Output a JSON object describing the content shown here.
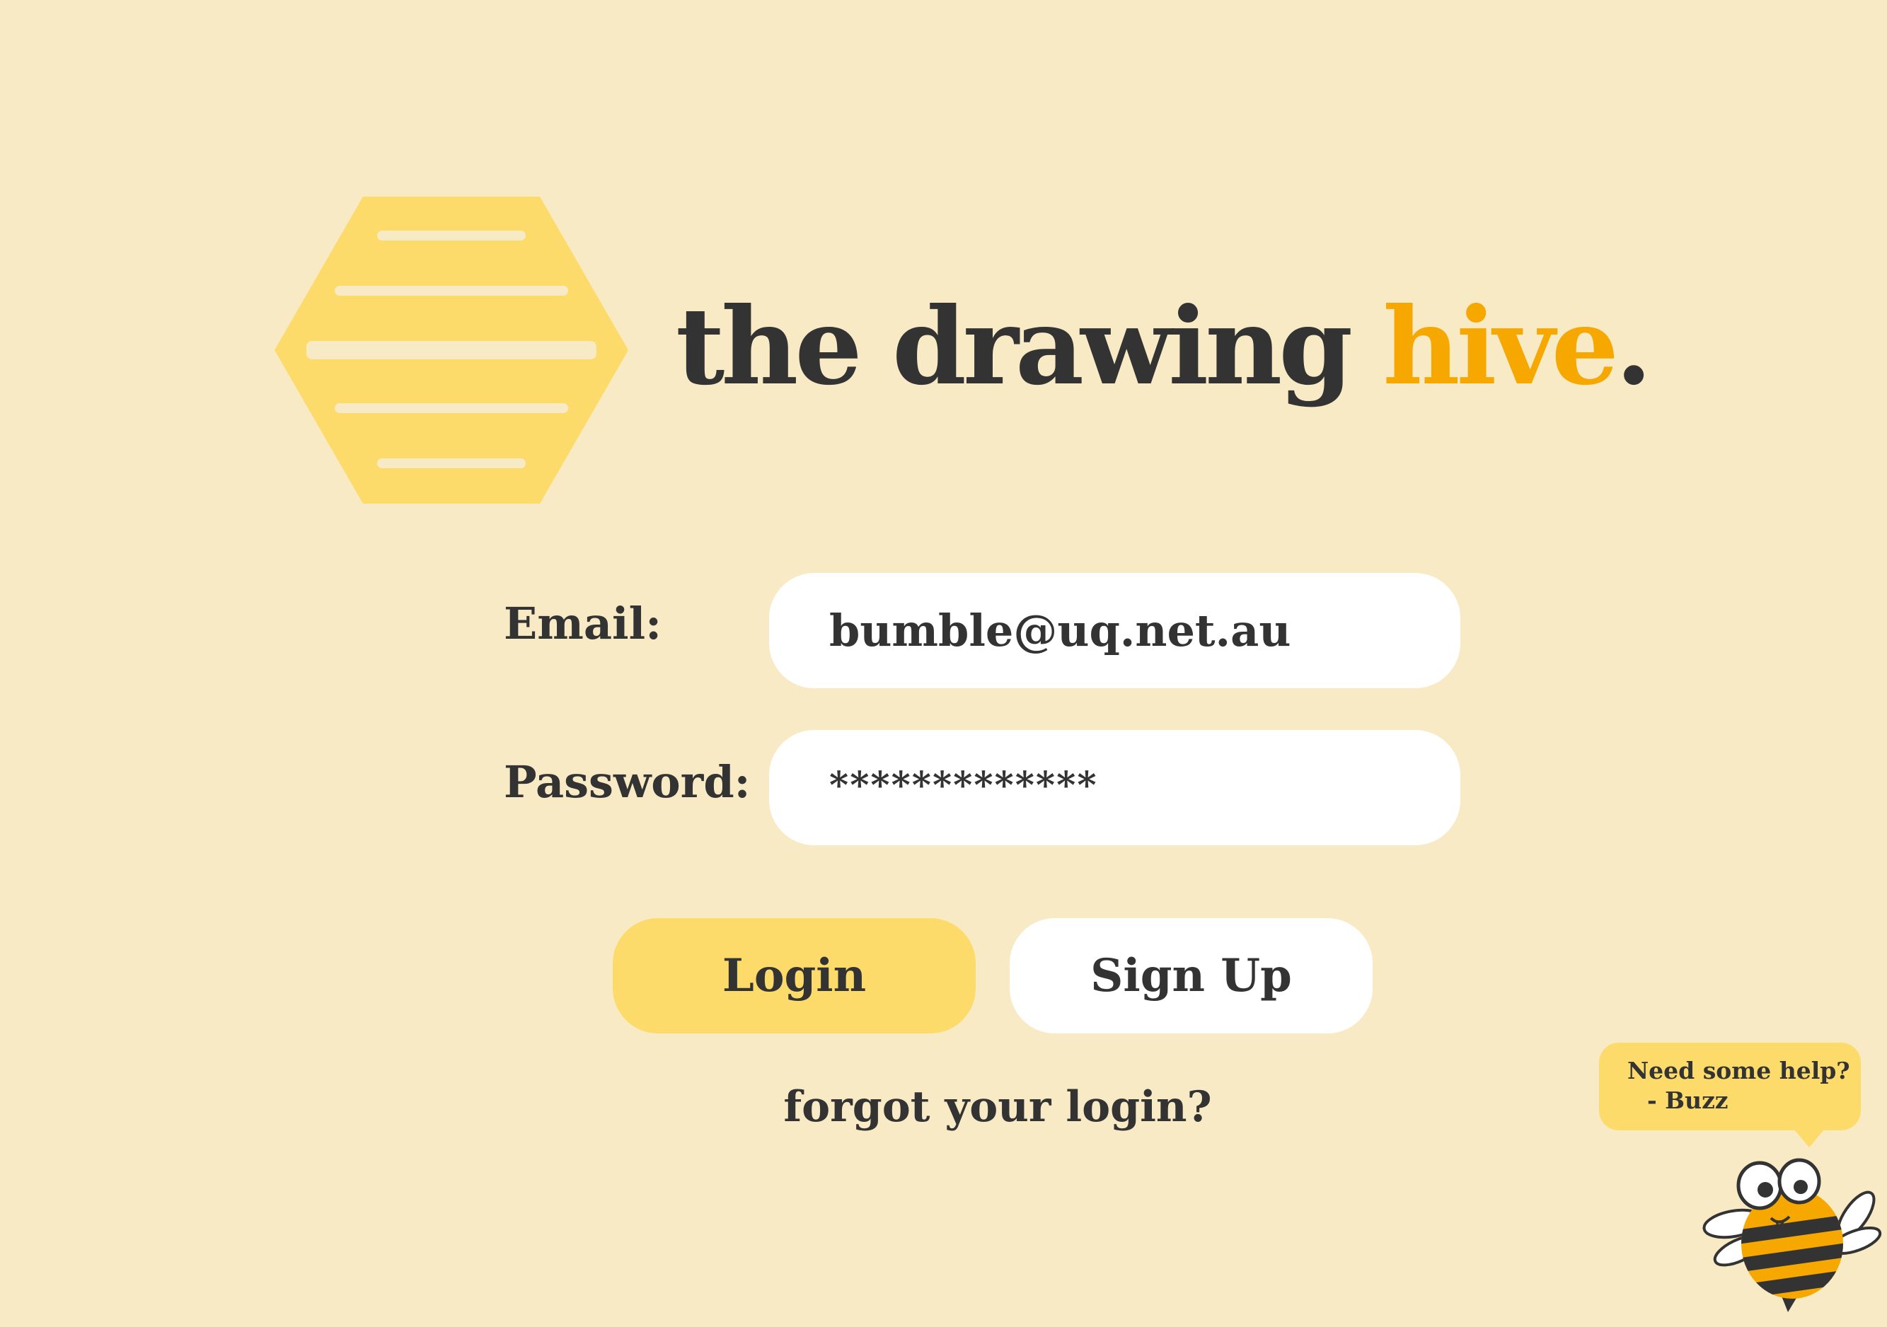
{
  "brand": {
    "title_main": "the drawing ",
    "title_accent": "hive",
    "title_period": ".",
    "accent_color": "#F6A800",
    "logo_icon": "hexagon-honeycomb-icon"
  },
  "login_form": {
    "email_label": "Email:",
    "email_value": "bumble@uq.net.au",
    "password_label": "Password:",
    "password_value": "*************"
  },
  "actions": {
    "login_label": "Login",
    "signup_label": "Sign Up",
    "forgot_label": "forgot your login?"
  },
  "help": {
    "line1": "Need some help?",
    "line2": "- Buzz",
    "mascot_icon": "bee-mascot-icon"
  },
  "colors": {
    "background": "#F8EAC4",
    "primary_button": "#FCDB6A",
    "text": "#333333"
  }
}
